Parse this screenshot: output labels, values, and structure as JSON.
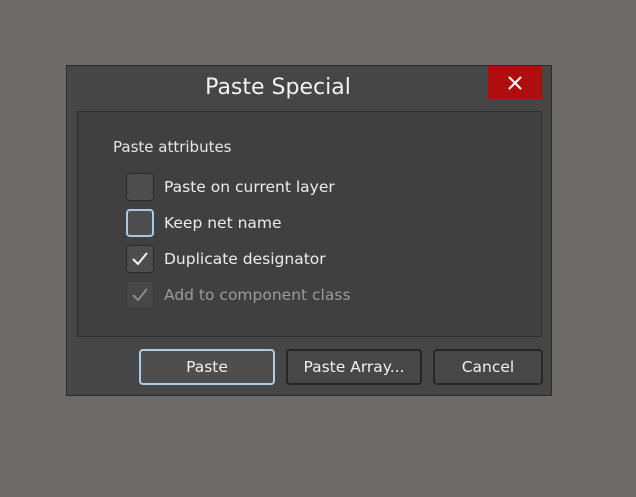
{
  "dialog": {
    "title": "Paste Special",
    "close_icon": "close-icon",
    "close_color": "#b00e0e"
  },
  "group": {
    "label": "Paste attributes"
  },
  "options": [
    {
      "label": "Paste on current layer",
      "checked": false,
      "focused": false,
      "disabled": false
    },
    {
      "label": "Keep net name",
      "checked": false,
      "focused": true,
      "disabled": false
    },
    {
      "label": "Duplicate designator",
      "checked": true,
      "focused": false,
      "disabled": false
    },
    {
      "label": "Add to component class",
      "checked": true,
      "focused": false,
      "disabled": true
    }
  ],
  "buttons": {
    "paste": "Paste",
    "paste_array": "Paste Array...",
    "cancel": "Cancel"
  },
  "icons": {
    "check": "checkmark-icon"
  },
  "colors": {
    "backdrop": "#6e6a69",
    "dialog_bg": "#464646",
    "focus_border": "#a9cde8"
  }
}
